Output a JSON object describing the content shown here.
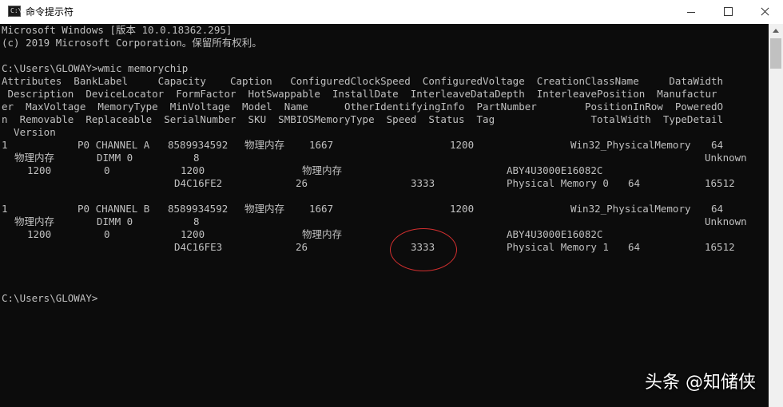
{
  "window": {
    "title": "命令提示符",
    "app_icon_label": "C:\\."
  },
  "console": {
    "banner": [
      "Microsoft Windows [版本 10.0.18362.295]",
      "(c) 2019 Microsoft Corporation。保留所有权利。"
    ],
    "command": "C:\\Users\\GLOWAY>wmic memorychip",
    "headers": [
      "Attributes  BankLabel     Capacity    Caption   ConfiguredClockSpeed  ConfiguredVoltage  CreationClassName     DataWidth",
      " Description  DeviceLocator  FormFactor  HotSwappable  InstallDate  InterleaveDataDepth  InterleavePosition  Manufactur",
      "er  MaxVoltage  MemoryType  MinVoltage  Model  Name      OtherIdentifyingInfo  PartNumber        PositionInRow  PoweredO",
      "n  Removable  Replaceable  SerialNumber  SKU  SMBIOSMemoryType  Speed  Status  Tag                TotalWidth  TypeDetail",
      "  Version"
    ],
    "chips": [
      {
        "attributes": "1",
        "bank_label": "P0 CHANNEL A",
        "capacity": "8589934592",
        "caption": "物理内存",
        "configured_clock_speed": "1667",
        "configured_voltage": "1200",
        "creation_class_name": "Win32_PhysicalMemory",
        "data_width": "64",
        "description": "物理内存",
        "device_locator": "DIMM 0",
        "form_factor": "8",
        "manufacturer": "Unknown",
        "max_voltage": "1200",
        "memory_type": "0",
        "min_voltage": "1200",
        "name": "物理内存",
        "part_number": "ABY4U3000E16082C",
        "serial_number": "D4C16FE2",
        "smbios_memory_type": "26",
        "speed": "3333",
        "tag": "Physical Memory 0",
        "total_width": "64",
        "type_detail": "16512"
      },
      {
        "attributes": "1",
        "bank_label": "P0 CHANNEL B",
        "capacity": "8589934592",
        "caption": "物理内存",
        "configured_clock_speed": "1667",
        "configured_voltage": "1200",
        "creation_class_name": "Win32_PhysicalMemory",
        "data_width": "64",
        "description": "物理内存",
        "device_locator": "DIMM 0",
        "form_factor": "8",
        "manufacturer": "Unknown",
        "max_voltage": "1200",
        "memory_type": "0",
        "min_voltage": "1200",
        "name": "物理内存",
        "part_number": "ABY4U3000E16082C",
        "serial_number": "D4C16FE3",
        "smbios_memory_type": "26",
        "speed": "3333",
        "tag": "Physical Memory 1",
        "total_width": "64",
        "type_detail": "16512"
      }
    ],
    "prompt": "C:\\Users\\GLOWAY>"
  },
  "watermark": "头条 @知储侠",
  "colors": {
    "console_bg": "#0c0c0c",
    "console_text": "#c0c0c0",
    "annotation_circle": "#d32f2f"
  }
}
